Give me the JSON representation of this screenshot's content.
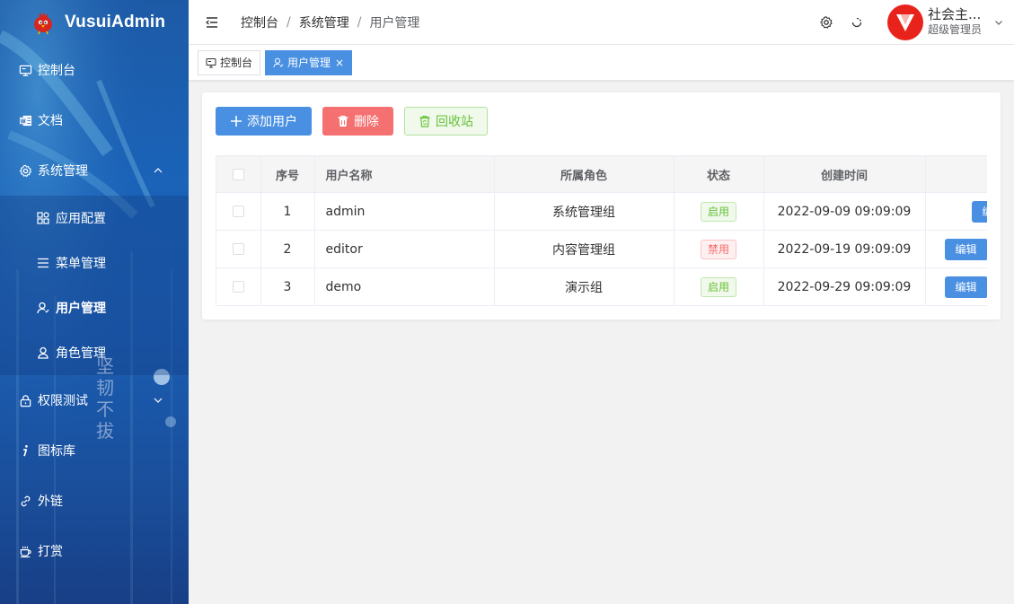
{
  "app": {
    "name": "VusuiAdmin"
  },
  "sidebar": {
    "items": [
      {
        "label": "控制台",
        "icon": "monitor-icon"
      },
      {
        "label": "文档",
        "icon": "word-doc-icon"
      },
      {
        "label": "系统管理",
        "icon": "gear-icon",
        "expanded": true,
        "children": [
          {
            "label": "应用配置",
            "icon": "apps-icon"
          },
          {
            "label": "菜单管理",
            "icon": "list-icon"
          },
          {
            "label": "用户管理",
            "icon": "user-icon",
            "active": true
          },
          {
            "label": "角色管理",
            "icon": "person-icon"
          }
        ]
      },
      {
        "label": "权限测试",
        "icon": "lock-icon",
        "expanded": false
      },
      {
        "label": "图标库",
        "icon": "info-i-icon"
      },
      {
        "label": "外链",
        "icon": "link-icon"
      },
      {
        "label": "打赏",
        "icon": "coffee-icon"
      }
    ],
    "decor_text": "坚韧不拔"
  },
  "header": {
    "breadcrumb": [
      "控制台",
      "系统管理",
      "用户管理"
    ],
    "breadcrumb_sep": "/",
    "user": {
      "name": "社会主...",
      "role": "超级管理员",
      "avatar_letter": "V"
    }
  },
  "tabs": [
    {
      "label": "控制台",
      "active": false
    },
    {
      "label": "用户管理",
      "active": true,
      "close": "×"
    }
  ],
  "toolbar": {
    "add_label": "添加用户",
    "delete_label": "删除",
    "recycle_label": "回收站"
  },
  "table": {
    "columns": [
      "序号",
      "用户名称",
      "所属角色",
      "状态",
      "创建时间",
      "操"
    ],
    "rows": [
      {
        "index": "1",
        "name": "admin",
        "role": "系统管理组",
        "status": "启用",
        "status_type": "success",
        "created": "2022-09-09 09:09:09",
        "action": "编辑"
      },
      {
        "index": "2",
        "name": "editor",
        "role": "内容管理组",
        "status": "禁用",
        "status_type": "danger",
        "created": "2022-09-19 09:09:09",
        "action": "编辑"
      },
      {
        "index": "3",
        "name": "demo",
        "role": "演示组",
        "status": "启用",
        "status_type": "success",
        "created": "2022-09-29 09:09:09",
        "action": "编辑"
      }
    ]
  },
  "colors": {
    "primary": "#4a90e2",
    "danger": "#f57070",
    "success": "#67c23a",
    "avatar": "#e8231c"
  }
}
